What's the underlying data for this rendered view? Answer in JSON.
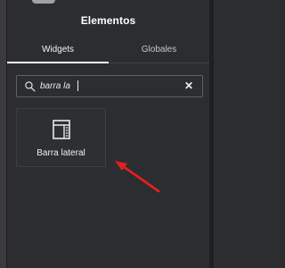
{
  "header": {
    "title": "Elementos"
  },
  "tabs": [
    {
      "label": "Widgets",
      "active": true
    },
    {
      "label": "Globales",
      "active": false
    }
  ],
  "search": {
    "value": "barra la",
    "placeholder": "",
    "search_icon": "search-icon",
    "clear_icon": "close-icon",
    "clear_symbol": "✕"
  },
  "results": {
    "items": [
      {
        "label": "Barra lateral",
        "icon": "sidebar-layout-icon"
      }
    ]
  },
  "annotation": {
    "type": "arrow",
    "color": "#e31f1f"
  },
  "colors": {
    "panel_bg": "#2b2d30",
    "text": "#ffffff",
    "border": "#5e6065",
    "accent": "#ffffff"
  }
}
